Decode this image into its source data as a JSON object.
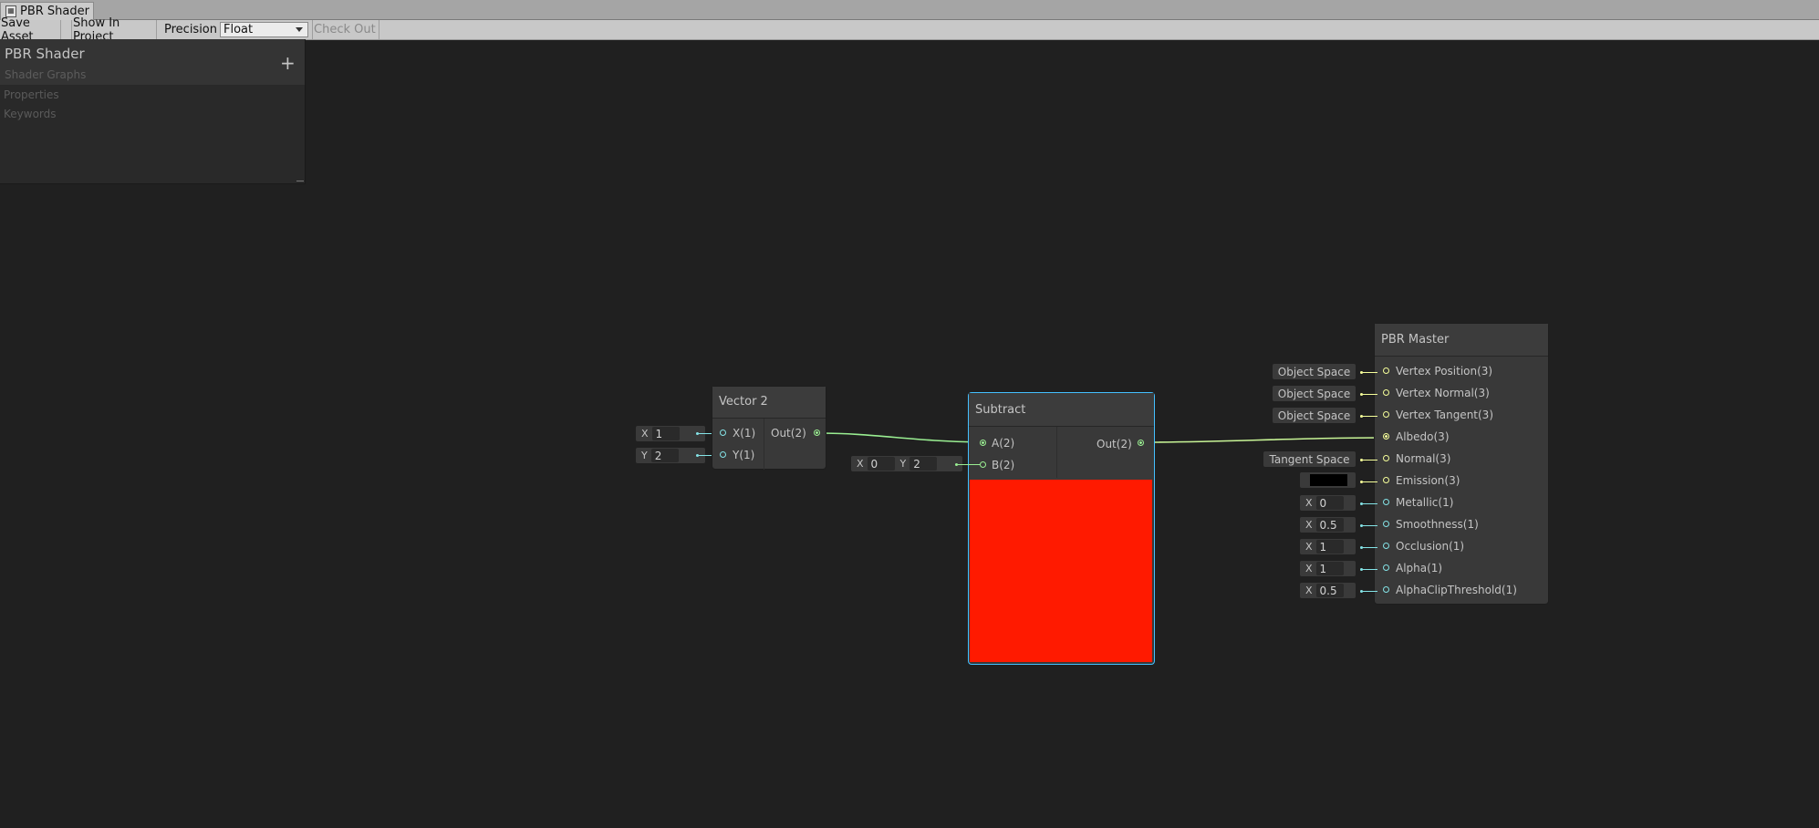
{
  "window": {
    "tab_title": "PBR Shader",
    "tab_icon": "shader-graph-icon"
  },
  "toolbar": {
    "save_asset": "Save Asset",
    "show_in_project": "Show In Project",
    "precision_label": "Precision",
    "precision_value": "Float",
    "check_out": "Check Out"
  },
  "blackboard": {
    "title": "PBR Shader",
    "subtitle": "Shader Graphs",
    "add_icon": "plus-icon",
    "sections": [
      "Properties",
      "Keywords"
    ]
  },
  "nodes": {
    "vector2": {
      "title": "Vector 2",
      "inputs": [
        {
          "label": "X(1)",
          "field_label": "X",
          "value": "1"
        },
        {
          "label": "Y(1)",
          "field_label": "Y",
          "value": "2"
        }
      ],
      "output": "Out(2)"
    },
    "subtract": {
      "title": "Subtract",
      "inputs": [
        {
          "label": "A(2)"
        },
        {
          "label": "B(2)",
          "fields": [
            {
              "label": "X",
              "value": "0"
            },
            {
              "label": "Y",
              "value": "2"
            }
          ]
        }
      ],
      "output": "Out(2)",
      "preview_color": "#ff1a00"
    },
    "pbr_master": {
      "title": "PBR Master",
      "ports": [
        {
          "label": "Vertex Position(3)",
          "control": "Object Space"
        },
        {
          "label": "Vertex Normal(3)",
          "control": "Object Space"
        },
        {
          "label": "Vertex Tangent(3)",
          "control": "Object Space"
        },
        {
          "label": "Albedo(3)",
          "control": ""
        },
        {
          "label": "Normal(3)",
          "control": "Tangent Space"
        },
        {
          "label": "Emission(3)",
          "control": "color",
          "color": "#000000"
        },
        {
          "label": "Metallic(1)",
          "field_label": "X",
          "value": "0"
        },
        {
          "label": "Smoothness(1)",
          "field_label": "X",
          "value": "0.5"
        },
        {
          "label": "Occlusion(1)",
          "field_label": "X",
          "value": "1"
        },
        {
          "label": "Alpha(1)",
          "field_label": "X",
          "value": "1"
        },
        {
          "label": "AlphaClipThreshold(1)",
          "field_label": "X",
          "value": "0.5"
        }
      ]
    }
  },
  "colors": {
    "canvas": "#202020",
    "node_bg": "#393939",
    "port_vector1": "#84e4e7",
    "port_vector3": "#f6ff9a",
    "port_vector2": "#9aef92",
    "selection": "#44c0ff"
  },
  "cursor_icon": "mouse-pointer-icon"
}
